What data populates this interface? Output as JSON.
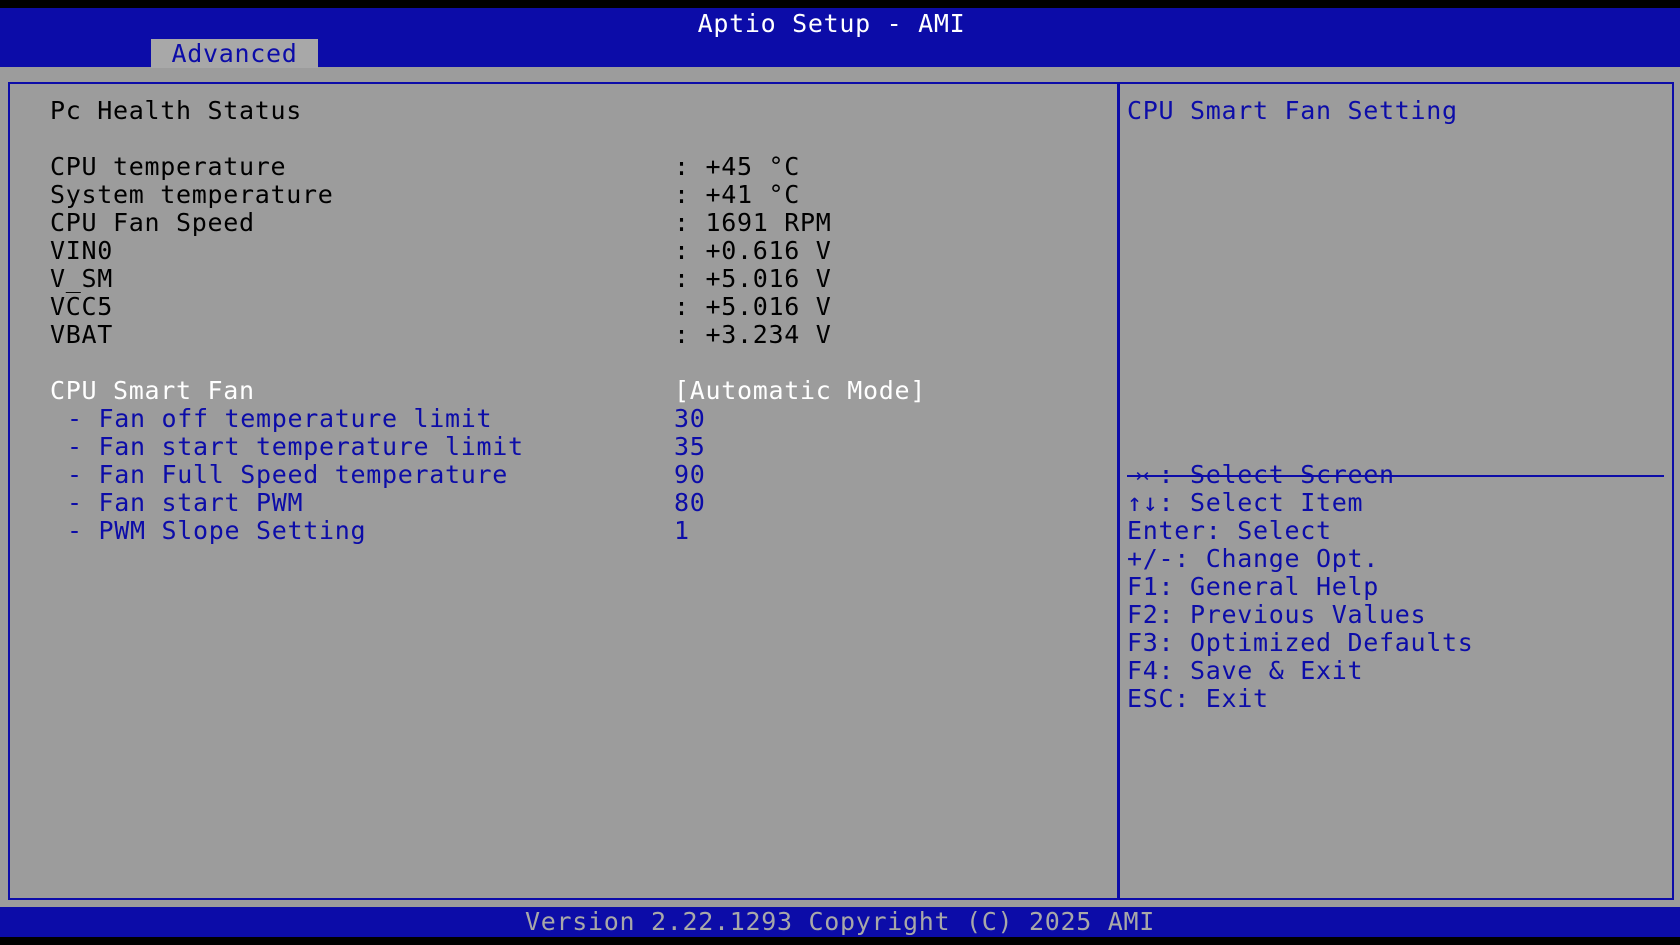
{
  "header": {
    "title": "Aptio Setup - AMI",
    "active_tab": "Advanced"
  },
  "main": {
    "section_title": "Pc Health Status",
    "readings": [
      {
        "label": "CPU temperature",
        "value": ": +45 °C"
      },
      {
        "label": "System temperature",
        "value": ": +41 °C"
      },
      {
        "label": "CPU Fan Speed",
        "value": ": 1691 RPM"
      },
      {
        "label": "VIN0",
        "value": ": +0.616 V"
      },
      {
        "label": "V_SM",
        "value": ": +5.016 V"
      },
      {
        "label": "VCC5",
        "value": ": +5.016 V"
      },
      {
        "label": "VBAT",
        "value": ": +3.234 V"
      }
    ],
    "smart_fan": {
      "label": "CPU Smart Fan",
      "value": "[Automatic Mode]"
    },
    "fan_settings": [
      {
        "label": "- Fan off temperature limit",
        "value": "30"
      },
      {
        "label": "- Fan start temperature limit",
        "value": "35"
      },
      {
        "label": "- Fan Full Speed temperature",
        "value": "90"
      },
      {
        "label": "- Fan start PWM",
        "value": "80"
      },
      {
        "label": "- PWM Slope Setting",
        "value": "1"
      }
    ]
  },
  "help": {
    "description": "CPU Smart Fan Setting",
    "keys": [
      {
        "icon": "arrows-left-right-icon",
        "text": "→←: Select Screen"
      },
      {
        "icon": "arrows-up-down-icon",
        "text": "↑↓: Select Item"
      },
      {
        "text": "Enter: Select"
      },
      {
        "text": "+/-: Change Opt."
      },
      {
        "text": "F1: General Help"
      },
      {
        "text": "F2: Previous Values"
      },
      {
        "text": "F3: Optimized Defaults"
      },
      {
        "text": "F4: Save & Exit"
      },
      {
        "text": "ESC: Exit"
      }
    ]
  },
  "footer": {
    "version": "Version 2.22.1293 Copyright (C) 2025 AMI"
  },
  "colors": {
    "frame_blue": "#0c0ca8",
    "panel_gray": "#9c9c9c",
    "highlight_white": "#ffffff"
  }
}
